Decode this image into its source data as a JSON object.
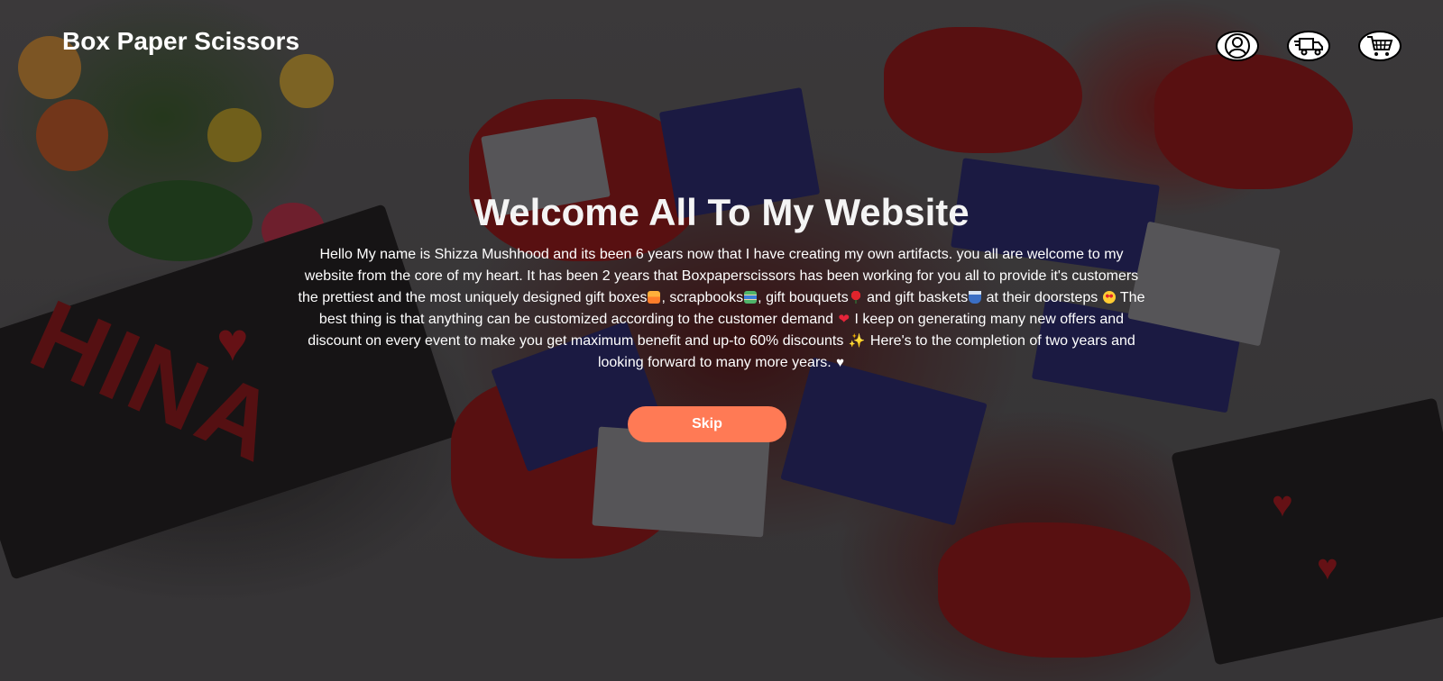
{
  "header": {
    "brand": "Box Paper Scissors",
    "icons": [
      "user-icon",
      "delivery-truck-icon",
      "shopping-cart-icon"
    ]
  },
  "hero": {
    "title": "Welcome All To My Website",
    "paragraph": {
      "part1": "Hello My name is Shizza Mushhood and its been 6 years now that I have creating my own artifacts. you all are welcome to my website from the core of my heart. It has been 2 years that Boxpaperscissors has been working for you all to provide it's customers the prettiest and the most uniquely designed gift boxes",
      "part2": ", scrapbooks",
      "part3": ", gift bouquets",
      "part4": " and gift baskets",
      "part5": "  at their doorsteps",
      "part6": " The best thing is that anything can be customized according to the customer demand",
      "part7": " I keep on generating many new offers and discount on every event to make you get maximum benefit and up-to 60% discounts",
      "part8": " Here's to the completion of two years and looking forward to many more years. "
    },
    "emojis": {
      "heart": "❤",
      "sparkles": "✨",
      "white_heart": "♥"
    },
    "skip_label": "Skip"
  },
  "colors": {
    "accent": "#ff7a55",
    "text": "#ffffff",
    "overlay": "rgba(0,0,0,0.38)"
  }
}
